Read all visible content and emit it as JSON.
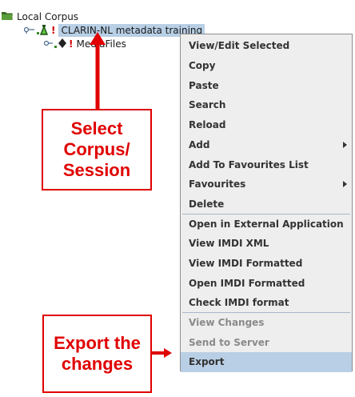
{
  "tree": {
    "root_label": "Local Corpus",
    "corpus_label": "CLARIN-NL metadata training",
    "child_label": "MediaFiles",
    "warning_glyph": "!"
  },
  "menu": {
    "items": [
      {
        "label": "View/Edit Selected"
      },
      {
        "label": "Copy"
      },
      {
        "label": "Paste"
      },
      {
        "label": "Search"
      },
      {
        "label": "Reload"
      },
      {
        "label": "Add",
        "submenu": true
      },
      {
        "label": "Add To Favourites List"
      },
      {
        "label": "Favourites",
        "submenu": true
      },
      {
        "label": "Delete"
      },
      {
        "label": "Open in External Application"
      },
      {
        "label": "View IMDI XML"
      },
      {
        "label": "View IMDI Formatted"
      },
      {
        "label": "Open IMDI Formatted"
      },
      {
        "label": "Check IMDI format"
      },
      {
        "label": "View Changes",
        "disabled": true
      },
      {
        "label": "Send to Server",
        "disabled": true
      },
      {
        "label": "Export",
        "active": true
      }
    ]
  },
  "callouts": {
    "select": [
      "Select",
      "Corpus/",
      "Session"
    ],
    "export": [
      "Export the",
      "changes"
    ]
  },
  "colors": {
    "annotation_red": "#e00000",
    "selection_blue": "#b8cfe5",
    "menu_background": "#eeeeee"
  }
}
